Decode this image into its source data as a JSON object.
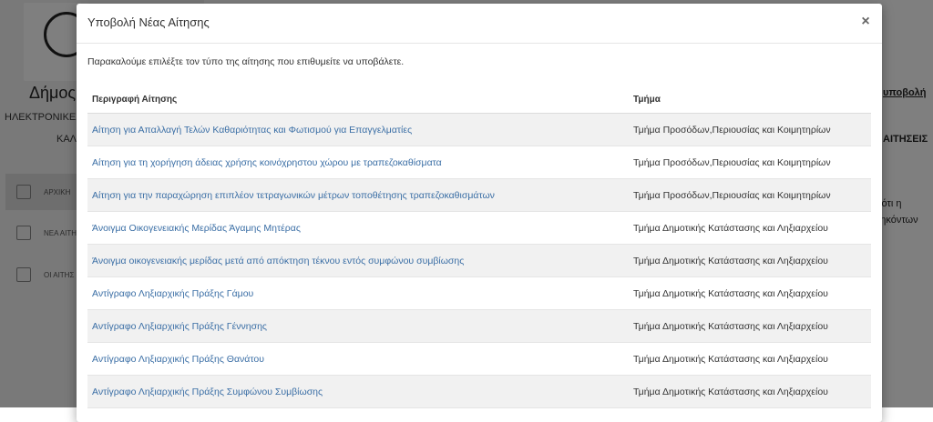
{
  "background": {
    "municipality": "Δήμος",
    "subtitle": "ΗΛΕΚΤΡΟΝΙΚΕΣ",
    "subtitle2": "ΚΑΛ",
    "nav": [
      {
        "label": "ΑΡΧΙΚΗ",
        "icon": "cube-icon",
        "active": true
      },
      {
        "label": "ΝΕΑ ΑΙΤΗ",
        "icon": "cube-icon",
        "active": false
      },
      {
        "label": "ΟΙ ΑΙΤΗΣ",
        "icon": "cube-icon",
        "active": false
      }
    ],
    "right_texts": [
      "υποβολή",
      "ΑΙΤΗΣΕΙΣ",
      "ν ότι η",
      "ηθηκόντων"
    ]
  },
  "modal": {
    "title": "Υποβολή Νέας Αίτησης",
    "close_label": "×",
    "intro": "Παρακαλούμε επιλέξτε τον τύπο της αίτησης που επιθυμείτε να υποβάλετε.",
    "columns": {
      "description": "Περιγραφή Αίτησης",
      "department": "Τμήμα"
    },
    "rows": [
      {
        "description": "Αίτηση για Απαλλαγή Τελών Καθαριότητας και Φωτισμού για Επαγγελματίες",
        "department": "Τμήμα Προσόδων,Περιουσίας και Κοιμητηρίων"
      },
      {
        "description": "Αίτηση για τη χορήγηση άδειας χρήσης κοινόχρηστου χώρου με τραπεζοκαθίσματα",
        "department": "Τμήμα Προσόδων,Περιουσίας και Κοιμητηρίων"
      },
      {
        "description": "Αίτηση για την παραχώρηση επιπλέον τετραγωνικών μέτρων τοποθέτησης τραπεζοκαθισμάτων",
        "department": "Τμήμα Προσόδων,Περιουσίας και Κοιμητηρίων"
      },
      {
        "description": "Άνοιγμα Οικογενειακής Μερίδας Άγαμης Μητέρας",
        "department": "Τμήμα Δημοτικής Κατάστασης και Ληξιαρχείου"
      },
      {
        "description": "Άνοιγμα οικογενειακής μερίδας μετά από απόκτηση τέκνου εντός συμφώνου συμβίωσης",
        "department": "Τμήμα Δημοτικής Κατάστασης και Ληξιαρχείου"
      },
      {
        "description": "Αντίγραφο Ληξιαρχικής Πράξης Γάμου",
        "department": "Τμήμα Δημοτικής Κατάστασης και Ληξιαρχείου"
      },
      {
        "description": "Αντίγραφο Ληξιαρχικής Πράξης Γέννησης",
        "department": "Τμήμα Δημοτικής Κατάστασης και Ληξιαρχείου"
      },
      {
        "description": "Αντίγραφο Ληξιαρχικής Πράξης Θανάτου",
        "department": "Τμήμα Δημοτικής Κατάστασης και Ληξιαρχείου"
      },
      {
        "description": "Αντίγραφο Ληξιαρχικής Πράξης Συμφώνου Συμβίωσης",
        "department": "Τμήμα Δημοτικής Κατάστασης και Ληξιαρχείου"
      }
    ]
  },
  "colors": {
    "link": "#3a6ea5",
    "overlay": "rgba(0,0,0,0.5)",
    "row_stripe": "#f1f1f1"
  }
}
